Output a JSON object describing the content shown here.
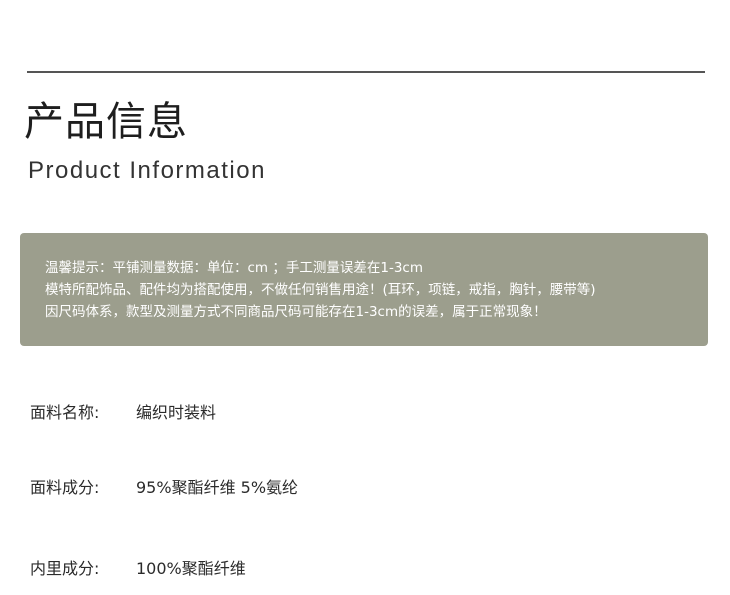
{
  "header": {
    "title_cn": "产品信息",
    "title_en": "Product Information"
  },
  "notice": {
    "lines": [
      "温馨提示：平铺测量数据：单位：cm ；手工测量误差在1-3cm",
      "模特所配饰品、配件均为搭配使用，不做任何销售用途！(耳环，项链，戒指，胸针，腰带等)",
      "因尺码体系，款型及测量方式不同商品尺码可能存在1-3cm的误差，属于正常现象！"
    ]
  },
  "specs": [
    {
      "label": "面料名称:",
      "value": "编织时装料"
    },
    {
      "label": "面料成分:",
      "value": "95%聚酯纤维 5%氨纶"
    },
    {
      "label": "内里成分:",
      "value": "100%聚酯纤维"
    }
  ],
  "colors": {
    "rule": "#555555",
    "notice_bg": "#9c9e8d",
    "notice_text": "#ffffff",
    "text": "#2b2b2b"
  }
}
